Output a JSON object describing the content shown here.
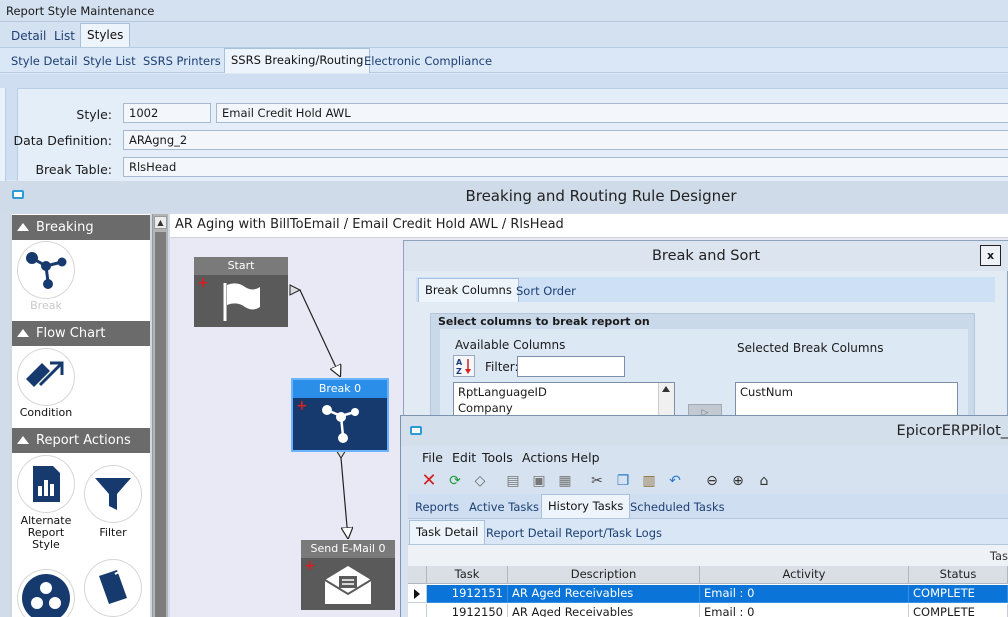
{
  "app": {
    "title": "Report Style Maintenance",
    "main_tabs": [
      "Detail",
      "List",
      "Styles"
    ],
    "sub_tabs": [
      "Style Detail",
      "Style List",
      "SSRS Printers",
      "SSRS Breaking/Routing",
      "Electronic Compliance"
    ]
  },
  "form": {
    "style_label": "Style:",
    "style_id": "1002",
    "style_desc": "Email Credit Hold AWL",
    "data_def_label": "Data Definition:",
    "data_def_value": "ARAgng_2",
    "break_table_label": "Break Table:",
    "break_table_value": "RlsHead"
  },
  "designer": {
    "title": "Breaking and Routing Rule Designer",
    "breadcrumb": "AR Aging with BillToEmail / Email Credit Hold AWL / RlsHead",
    "palette": {
      "breaking_header": "Breaking",
      "break_item": "Break",
      "flow_header": "Flow Chart",
      "condition_item": "Condition",
      "actions_header": "Report Actions",
      "alt_style_item": "Alternate Report Style",
      "filter_item": "Filter"
    },
    "nodes": {
      "start": "Start",
      "break0": "Break 0",
      "email0": "Send E-Mail 0"
    }
  },
  "break_sort": {
    "title": "Break and Sort",
    "close": "x",
    "tabs": [
      "Break Columns",
      "Sort Order"
    ],
    "group_title": "Select columns to break report on",
    "available_label": "Available Columns",
    "filter_label": "Filter:",
    "filter_value": "",
    "selected_label": "Selected Break Columns",
    "available": [
      "RptLanguageID",
      "Company"
    ],
    "selected": [
      "CustNum"
    ]
  },
  "erp": {
    "title": "EpicorERPPilot_",
    "menu": [
      "File",
      "Edit",
      "Tools",
      "Actions",
      "Help"
    ],
    "tabs": [
      "Reports",
      "Active Tasks",
      "History Tasks",
      "Scheduled Tasks"
    ],
    "subtabs": [
      "Task Detail",
      "Report Detail",
      "Report/Task Logs"
    ],
    "strip_text": "Tas",
    "columns": [
      "Task",
      "Description",
      "Activity",
      "Status"
    ],
    "rows": [
      {
        "task": "1912151",
        "description": "AR Aged Receivables",
        "activity": "Email : 0",
        "status": "COMPLETE"
      },
      {
        "task": "1912150",
        "description": "AR Aged Receivables",
        "activity": "Email : 0",
        "status": "COMPLETE"
      }
    ]
  }
}
